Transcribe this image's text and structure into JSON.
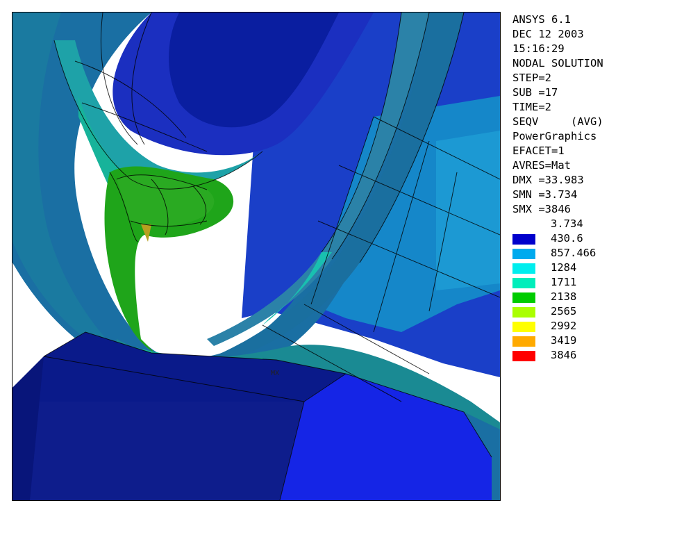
{
  "info": [
    "ANSYS 6.1",
    "DEC 12 2003",
    "15:16:29",
    "NODAL SOLUTION",
    "STEP=2",
    "SUB =17",
    "TIME=2",
    "SEQV     (AVG)",
    "PowerGraphics",
    "EFACET=1",
    "AVRES=Mat",
    "DMX =33.983",
    "SMN =3.734",
    "SMX =3846"
  ],
  "legend": {
    "min_value": "3.734",
    "entries": [
      {
        "value": "430.6",
        "color": "#0000cc"
      },
      {
        "value": "857.466",
        "color": "#00aaee"
      },
      {
        "value": "1284",
        "color": "#00eeee"
      },
      {
        "value": "1711",
        "color": "#00eebb"
      },
      {
        "value": "2138",
        "color": "#00cc00"
      },
      {
        "value": "2565",
        "color": "#aaff00"
      },
      {
        "value": "2992",
        "color": "#ffff00"
      },
      {
        "value": "3419",
        "color": "#ffaa00"
      },
      {
        "value": "3846",
        "color": "#ff0000"
      }
    ]
  },
  "plot": {
    "max_marker": "MX"
  }
}
